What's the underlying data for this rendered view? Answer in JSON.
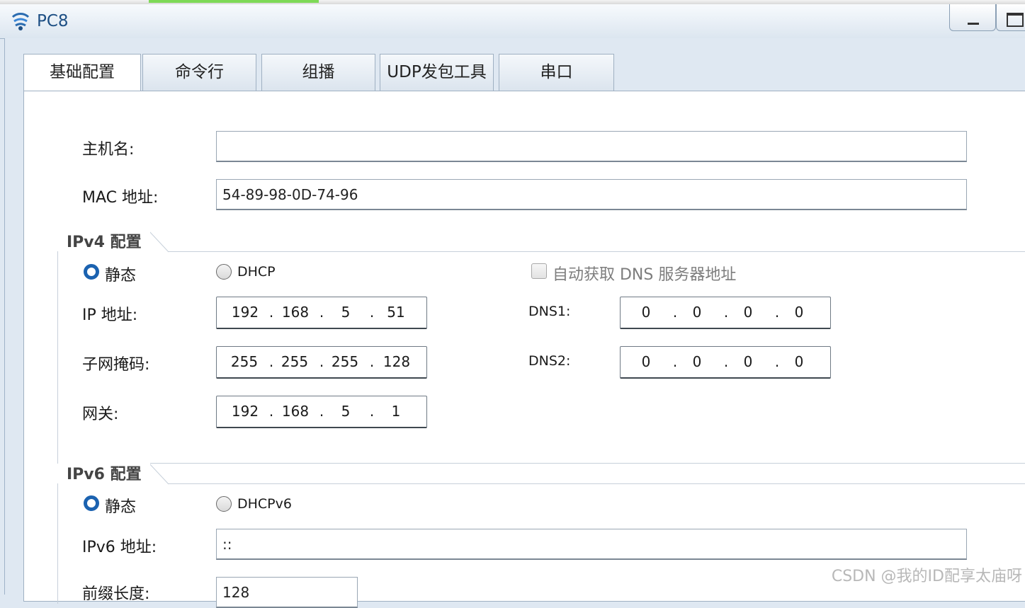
{
  "window": {
    "title": "PC8"
  },
  "tabs": [
    {
      "label": "基础配置",
      "active": true
    },
    {
      "label": "命令行",
      "active": false
    },
    {
      "label": "组播",
      "active": false
    },
    {
      "label": "UDP发包工具",
      "active": false
    },
    {
      "label": "串口",
      "active": false
    }
  ],
  "basic": {
    "hostname_label": "主机名:",
    "hostname_value": "",
    "mac_label": "MAC 地址:",
    "mac_value": "54-89-98-0D-74-96"
  },
  "ipv4": {
    "group_title": "IPv4 配置",
    "static_label": "静态",
    "dhcp_label": "DHCP",
    "mode": "static",
    "auto_dns_label": "自动获取 DNS 服务器地址",
    "auto_dns_checked": false,
    "ip_label": "IP 地址:",
    "ip": [
      "192",
      "168",
      "5",
      "51"
    ],
    "mask_label": "子网掩码:",
    "mask": [
      "255",
      "255",
      "255",
      "128"
    ],
    "gateway_label": "网关:",
    "gateway": [
      "192",
      "168",
      "5",
      "1"
    ],
    "dns1_label": "DNS1:",
    "dns1": [
      "0",
      "0",
      "0",
      "0"
    ],
    "dns2_label": "DNS2:",
    "dns2": [
      "0",
      "0",
      "0",
      "0"
    ]
  },
  "ipv6": {
    "group_title": "IPv6 配置",
    "static_label": "静态",
    "dhcp_label": "DHCPv6",
    "mode": "static",
    "addr_label": "IPv6 地址:",
    "addr_value": "::",
    "prefix_label": "前缀长度:",
    "prefix_value": "128"
  },
  "watermark": "CSDN @我的ID配享太庙呀",
  "colors": {
    "accent": "#1b62b0",
    "title": "#1d4f84"
  }
}
